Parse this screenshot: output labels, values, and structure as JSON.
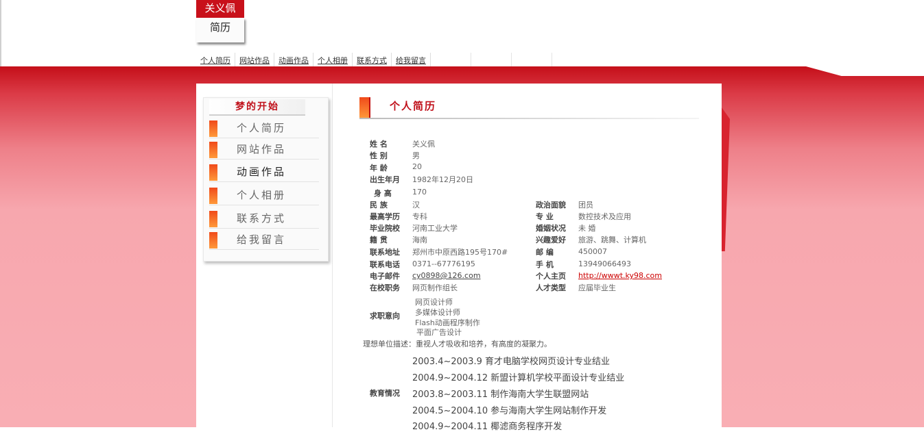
{
  "logo": {
    "name": "关义佩",
    "subtitle": "简历"
  },
  "nav": [
    "个人简历",
    "网站作品",
    "动画作品",
    "个人相册",
    "联系方式",
    "给我留言"
  ],
  "sidebar": {
    "title": "梦的开始",
    "items": [
      {
        "label": "个人简历"
      },
      {
        "label": "网站作品"
      },
      {
        "label": "动画作品"
      },
      {
        "label": "个人相册"
      },
      {
        "label": "联系方式"
      },
      {
        "label": "给我留言"
      }
    ]
  },
  "section_title": "个人简历",
  "profile": {
    "name_label": "姓    名",
    "name": "关义佩",
    "gender_label": "性    别",
    "gender": "男",
    "age_label": "年    龄",
    "age": "20",
    "birth_label": "出生年月",
    "birth": "1982年12月20日",
    "height_label": "身  高",
    "height": "170",
    "ethnicity_label": "民    族",
    "ethnicity": "汉",
    "political_label": "政治面貌",
    "political": "团员",
    "education_label": "最高学历",
    "education": "专科",
    "major_label": "专    业",
    "major": "数控技术及应用",
    "school_label": "毕业院校",
    "school": "河南工业大学",
    "marital_label": "婚姻状况",
    "marital": "未 婚",
    "native_label": "籍    贯",
    "native": "海南",
    "hobby_label": "兴趣爱好",
    "hobby": "旅游、跳舞、计算机",
    "address_label": "联系地址",
    "address": "郑州市中原西路195号170#",
    "postcode_label": "邮    编",
    "postcode": "450007",
    "phone_label": "联系电话",
    "phone": "0371--67776195",
    "mobile_label": "手    机",
    "mobile": "13949066493",
    "email_label": "电子邮件",
    "email": "cy0898@126.com",
    "homepage_label": "个人主页",
    "homepage": "http://wwwt.ky98.com",
    "position_label": "在校职务",
    "position": "网页制作组长",
    "talent_label": "人才类型",
    "talent": "应届毕业生"
  },
  "job_intent": {
    "label": "求职意向",
    "items": [
      "网页设计师",
      "多媒体设计师",
      "Flash动画程序制作",
      "平面广告设计"
    ]
  },
  "ideal_employer": "理想单位描述：重视人才吸收和培养，有高度的凝聚力。",
  "education_history": {
    "label": "教育情况",
    "items": [
      "2003.4~2003.9 育才电脑学校网页设计专业结业",
      "2004.9~2004.12 新盟计算机学校平面设计专业结业",
      "2003.8~2003.11 制作海南大学生联盟网站",
      "2004.5~2004.10 参与海南大学生网站制作开发",
      "2004.9~2004.11 椰滤商务程序开发"
    ]
  }
}
